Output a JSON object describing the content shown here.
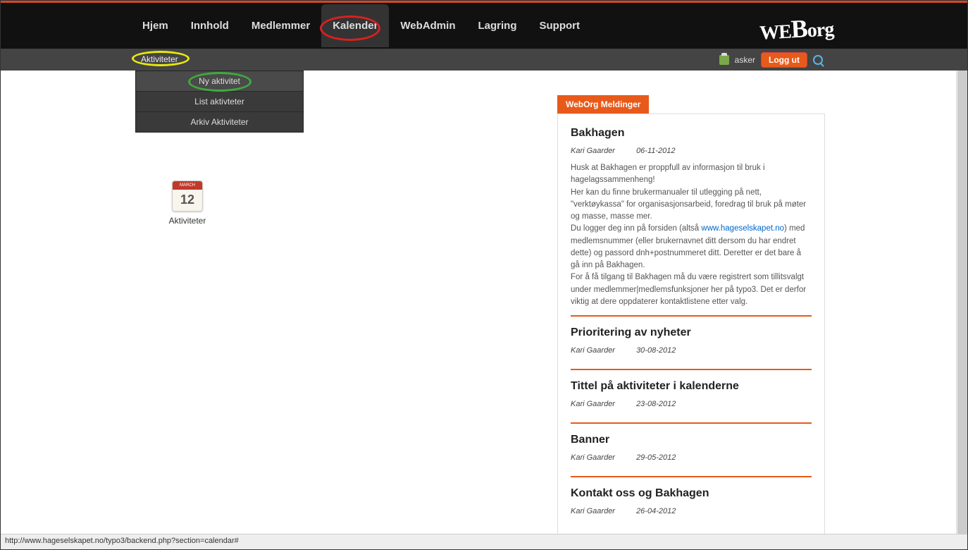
{
  "nav": {
    "items": [
      "Hjem",
      "Innhold",
      "Medlemmer",
      "Kalender",
      "WebAdmin",
      "Lagring",
      "Support"
    ],
    "active": "Kalender"
  },
  "logo": {
    "part1": "WE",
    "part2": "B",
    "part3": "org"
  },
  "subbar": {
    "label": "Aktiviteter",
    "username": "asker",
    "logout": "Logg ut"
  },
  "dropdown": {
    "items": [
      "Ny aktivitet",
      "List aktivteter",
      "Arkiv Aktiviteter"
    ],
    "highlighted": "Ny aktivitet"
  },
  "iconbox": {
    "month": "MARCH",
    "day": "12",
    "label": "Aktiviteter"
  },
  "messages": {
    "tab": "WebOrg Meldinger",
    "items": [
      {
        "title": "Bakhagen",
        "author": "Kari Gaarder",
        "date": "06-11-2012",
        "body_pre": "Husk at Bakhagen er proppfull av informasjon til bruk i hagelagssammenheng!\nHer kan du finne brukermanualer til utlegging på nett, \"verktøykassa\" for organisasjonsarbeid, foredrag til bruk på møter og masse, masse mer.\nDu logger deg inn på forsiden (altså ",
        "link": "www.hageselskapet.no",
        "body_post": ") med medlemsnummer (eller brukernavnet ditt dersom du har endret dette) og passord dnh+postnummeret ditt. Deretter er det bare å gå inn på Bakhagen.\nFor å få tilgang til Bakhagen må du være registrert som tillitsvalgt under medlemmer|medlemsfunksjoner her på typo3. Det er derfor viktig at dere oppdaterer kontaktlistene etter valg."
      },
      {
        "title": "Prioritering av nyheter",
        "author": "Kari Gaarder",
        "date": "30-08-2012"
      },
      {
        "title": "Tittel på aktiviteter i kalenderne",
        "author": "Kari Gaarder",
        "date": "23-08-2012"
      },
      {
        "title": "Banner",
        "author": "Kari Gaarder",
        "date": "29-05-2012"
      },
      {
        "title": "Kontakt oss og Bakhagen",
        "author": "Kari Gaarder",
        "date": "26-04-2012"
      }
    ]
  },
  "statusbar": "http://www.hageselskapet.no/typo3/backend.php?section=calendar#"
}
